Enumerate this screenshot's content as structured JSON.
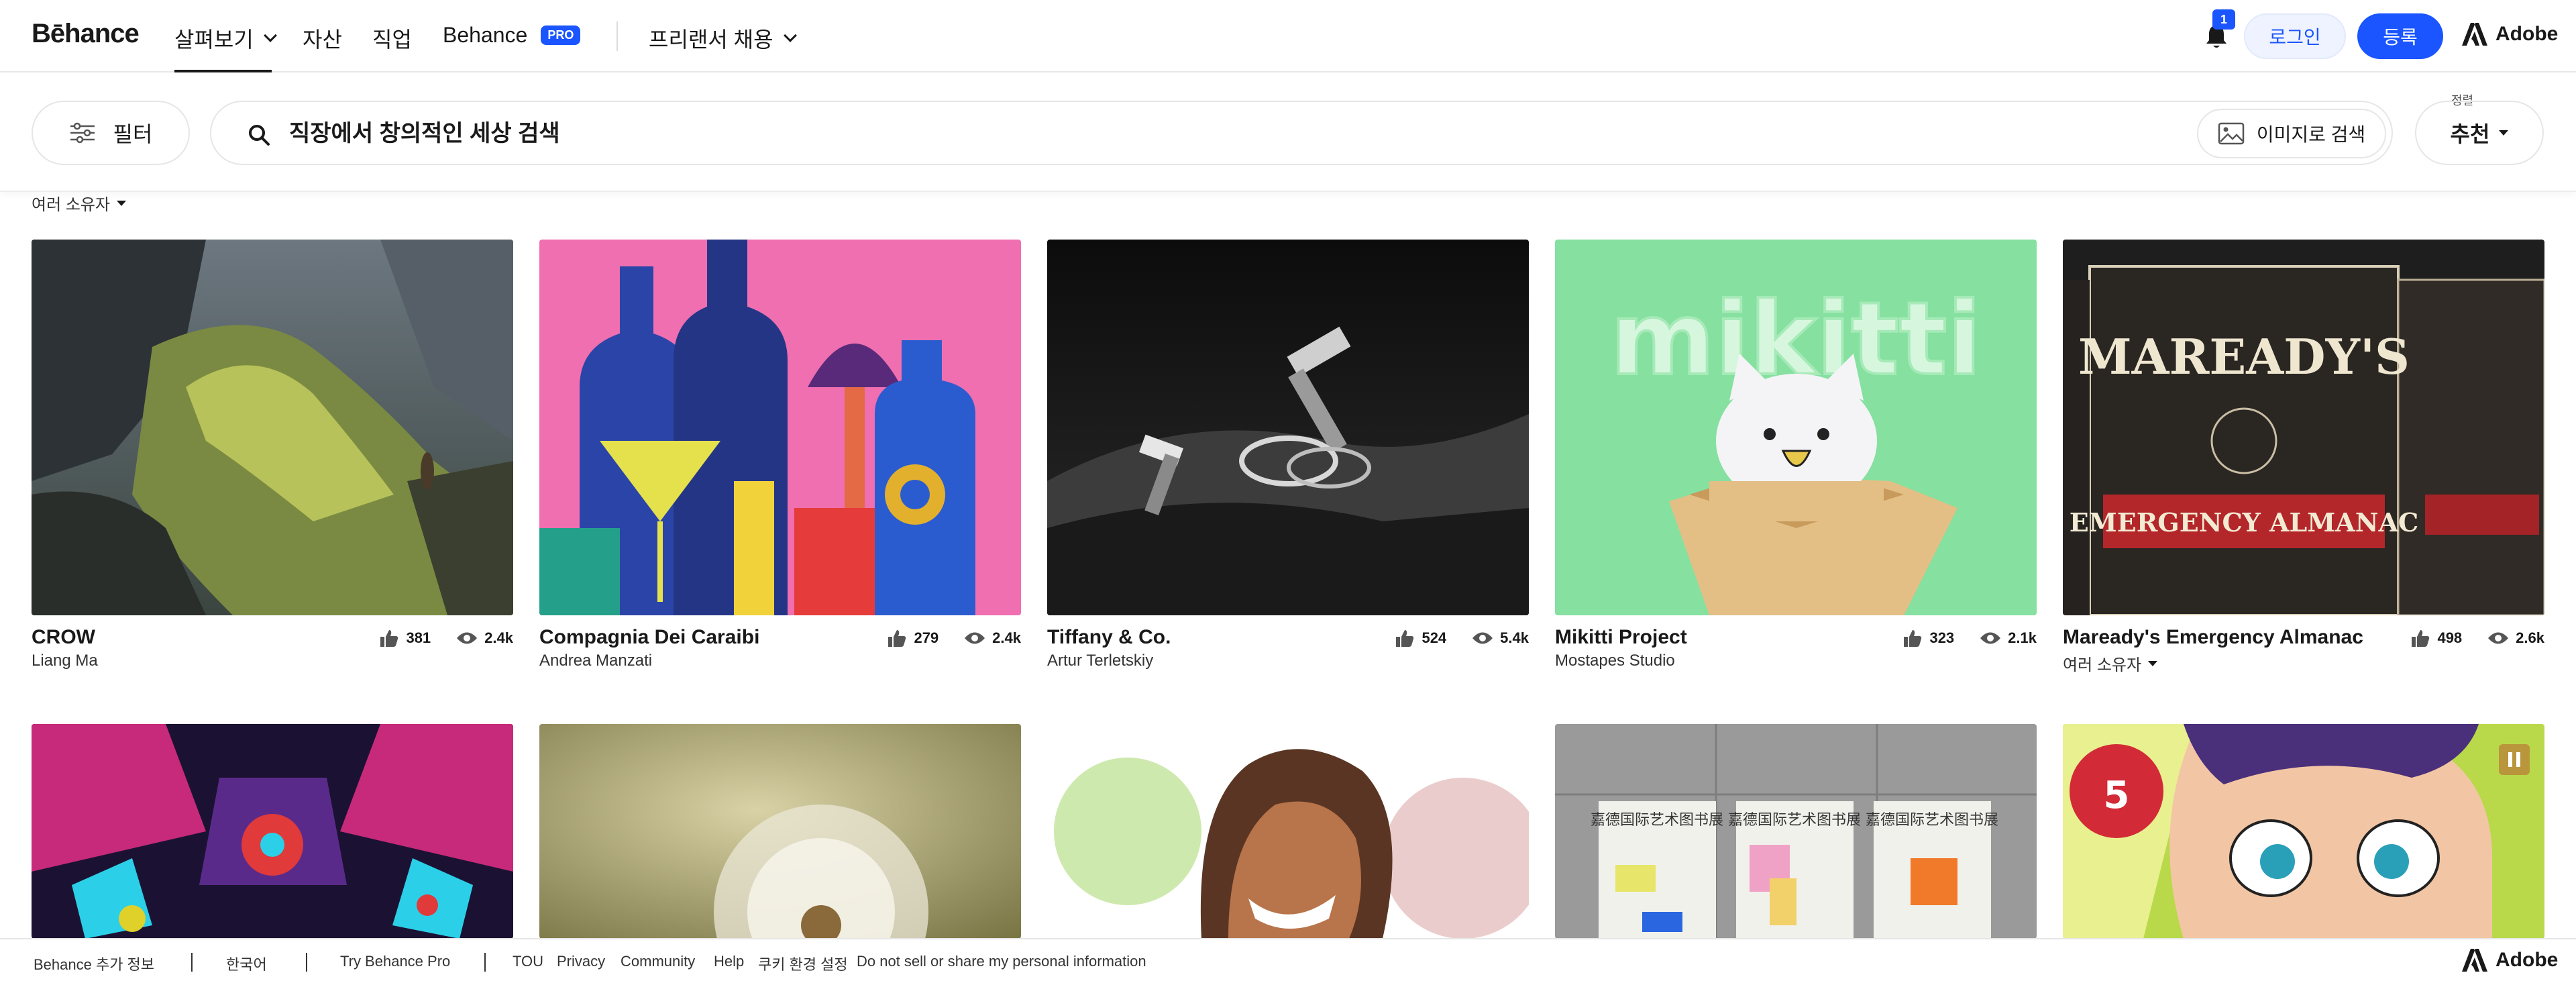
{
  "nav": {
    "logo": "Bēhance",
    "items": [
      {
        "label": "살펴보기"
      },
      {
        "label": "자산"
      },
      {
        "label": "직업"
      },
      {
        "label": "Behance",
        "badge": "PRO"
      },
      {
        "label": "프리랜서 채용"
      }
    ],
    "notification_count": "1",
    "login_label": "로그인",
    "signup_label": "등록",
    "adobe_label": "Adobe"
  },
  "search": {
    "filter_label": "필터",
    "placeholder": "직장에서 창의적인 세상 검색",
    "image_search_label": "이미지로 검색",
    "sort_caption": "정렬",
    "sort_value": "추천"
  },
  "owners_filter_label": "여러 소유자",
  "projects": [
    {
      "title": "CROW",
      "owner": "Liang Ma",
      "likes": "381",
      "views": "2.4k"
    },
    {
      "title": "Compagnia Dei Caraibi",
      "owner": "Andrea Manzati",
      "likes": "279",
      "views": "2.4k"
    },
    {
      "title": "Tiffany & Co.",
      "owner": "Artur Terletskiy",
      "likes": "524",
      "views": "5.4k"
    },
    {
      "title": "Mikitti Project",
      "owner": "Mostapes Studio",
      "likes": "323",
      "views": "2.1k"
    },
    {
      "title": "Maready's Emergency Almanac",
      "owner": "여러 소유자",
      "likes": "498",
      "views": "2.6k"
    }
  ],
  "thumb_text": {
    "mikitti": "mikitti",
    "almanac_title": "MAREADY'S",
    "almanac_sub": "EMERGENCY ALMANAC",
    "poster_text": "嘉德国际艺术图书展",
    "badge_number": "5"
  },
  "footer": {
    "more_info": "Behance 추가 정보",
    "language": "한국어",
    "try_pro": "Try Behance Pro",
    "links": [
      "TOU",
      "Privacy",
      "Community",
      "Help",
      "쿠키 환경 설정",
      "Do not sell or share my personal information"
    ],
    "adobe_label": "Adobe"
  },
  "colors": {
    "accent": "#1a55ff",
    "text": "#191919"
  }
}
